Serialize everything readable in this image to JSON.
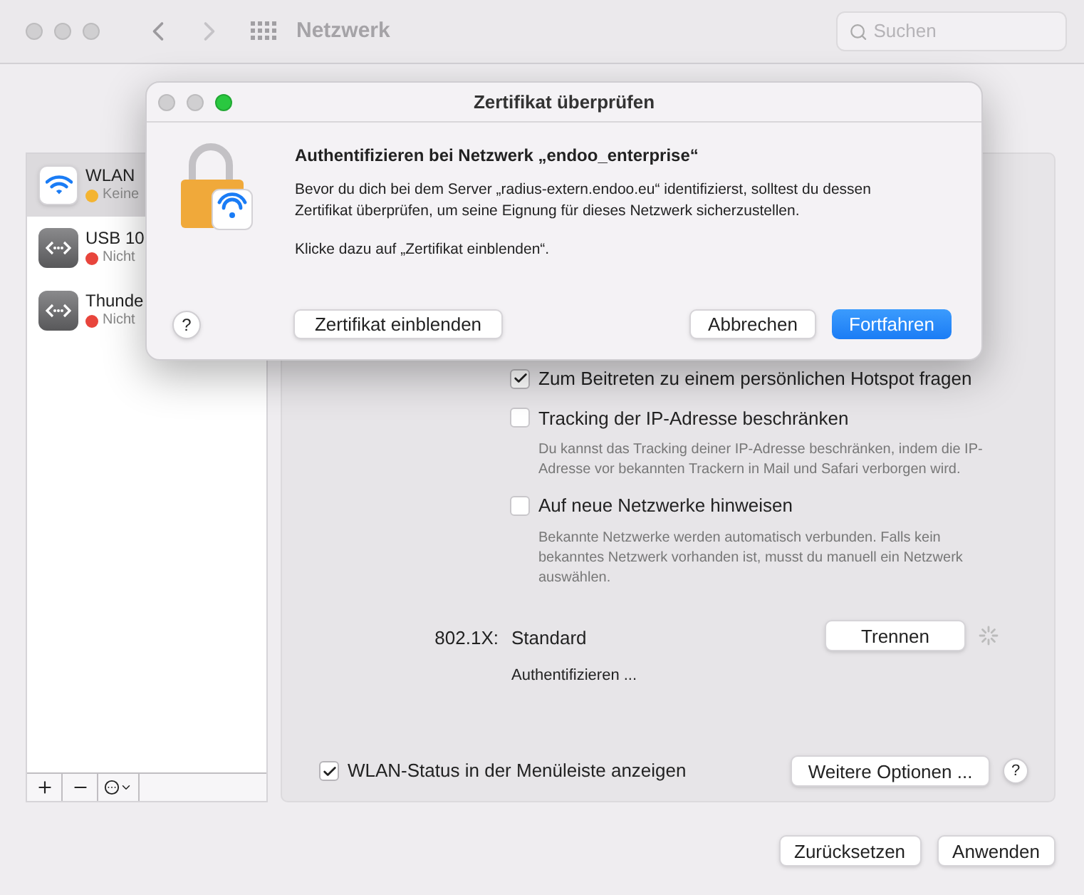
{
  "toolbar": {
    "title": "Netzwerk",
    "search": {
      "placeholder": "Suchen"
    }
  },
  "sidebar": {
    "items": [
      {
        "name": "WLAN",
        "status": "Keine",
        "color": "#f4b431",
        "kind": "wifi",
        "selected": true
      },
      {
        "name": "USB 10",
        "status": "Nicht",
        "color": "#e8453c",
        "kind": "ethernet",
        "selected": false
      },
      {
        "name": "Thunde",
        "status": "Nicht",
        "color": "#e8453c",
        "kind": "ethernet",
        "selected": false
      }
    ]
  },
  "panel": {
    "options": [
      {
        "label": "Zum Beitreten zu einem persönlichen Hotspot fragen",
        "checked": true
      },
      {
        "label": "Tracking der IP-Adresse beschränken",
        "checked": false,
        "description": "Du kannst das Tracking deiner IP-Adresse beschränken, indem die IP-Adresse vor bekannten Trackern in Mail und Safari verborgen wird."
      },
      {
        "label": "Auf neue Netzwerke hinweisen",
        "checked": false,
        "description": "Bekannte Netzwerke werden automatisch verbunden. Falls kein bekanntes Netzwerk vorhanden ist, musst du manuell ein Netzwerk auswählen."
      }
    ],
    "dot1x": {
      "label": "802.1X:",
      "value": "Standard",
      "status": "Authentifizieren ...",
      "button": "Trennen"
    },
    "menu_bar_option": {
      "label": "WLAN-Status in der Menüleiste anzeigen",
      "checked": true
    },
    "more_button": "Weitere Optionen ...",
    "help": "?"
  },
  "buttons": [
    "Zurücksetzen",
    "Anwenden"
  ],
  "dialog": {
    "title": "Zertifikat überprüfen",
    "heading": "Authentifizieren bei Netzwerk „endoo_enterprise“",
    "message": "Bevor du dich bei dem Server „radius-extern.endoo.eu“ identifizierst, solltest du dessen Zertifikat überprüfen, um seine Eignung für dieses Netzwerk sicherzustellen.",
    "hint": "Klicke dazu auf „Zertifikat einblenden“.",
    "help": "?",
    "show_button": "Zertifikat einblenden",
    "cancel_button": "Abbrechen",
    "continue_button": "Fortfahren"
  }
}
